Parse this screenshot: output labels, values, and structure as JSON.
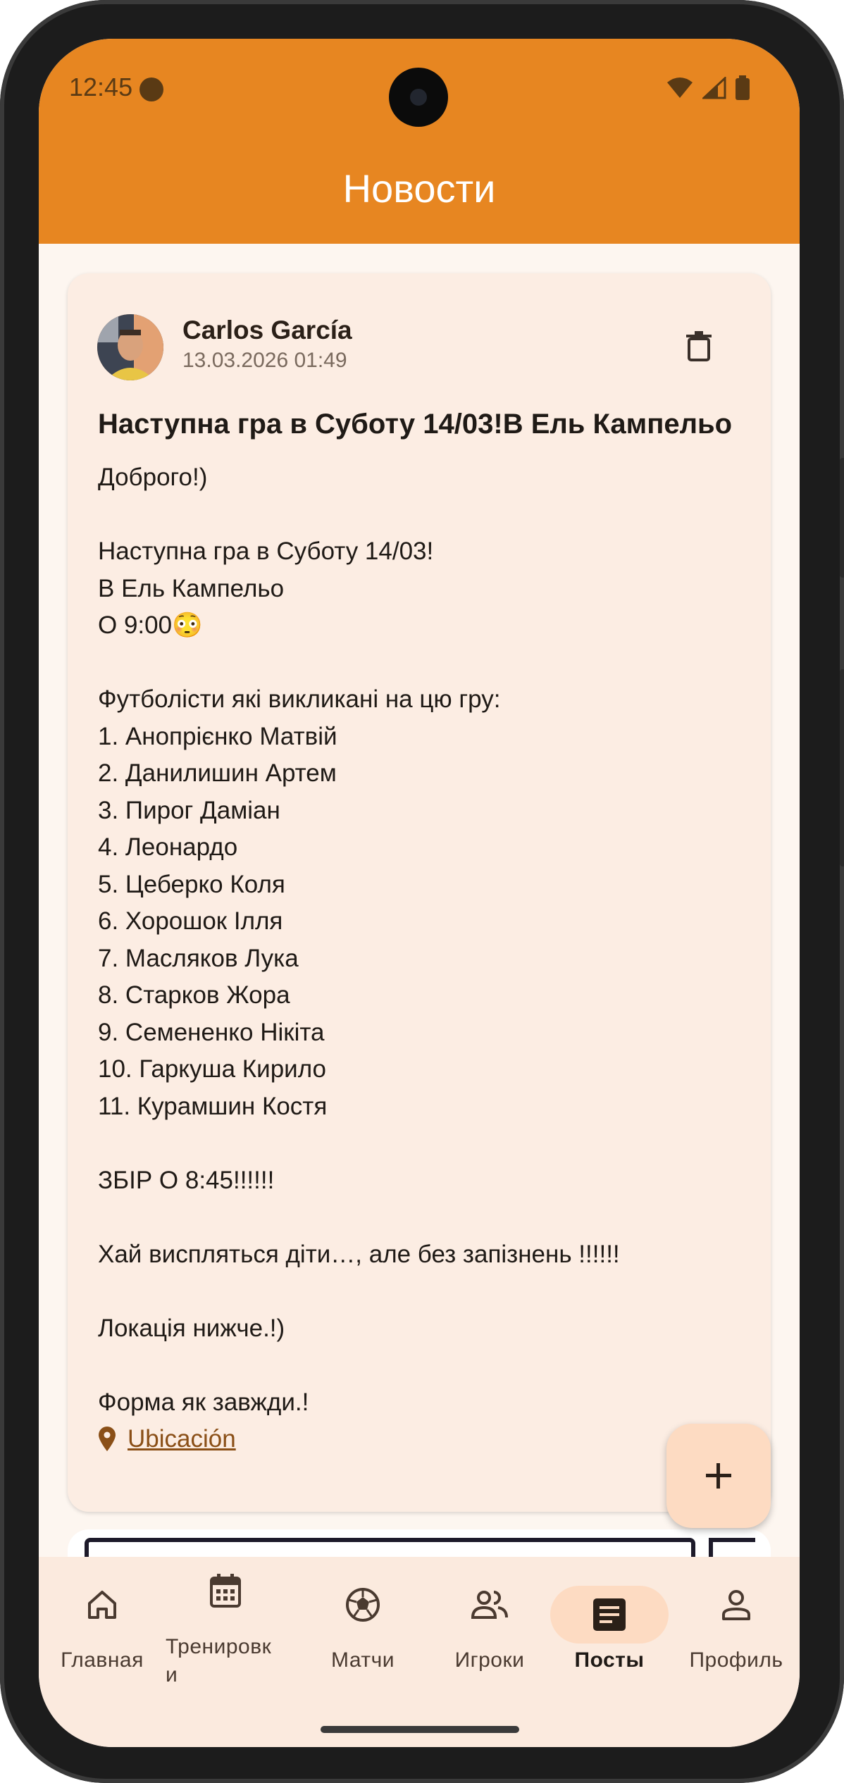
{
  "status_bar": {
    "time": "12:45"
  },
  "appbar": {
    "title": "Новости"
  },
  "post": {
    "author": "Carlos García",
    "date": "13.03.2026 01:49",
    "title": "Наступна гра в Суботу 14/03!В Ель Кампельо",
    "body_lines": [
      "Доброго!)",
      "",
      "Наступна гра в Суботу 14/03!",
      "В Ель Кампельо",
      "О 9:00😳",
      "",
      "Футболісти які викликані на цю гру:",
      "1. Анопрієнко Матвій",
      "2. Данилишин Артем",
      "3. Пирог Даміан",
      "4. Леонардо",
      "5. Цеберко Коля",
      "6. Хорошок Ілля",
      "7. Масляков Лука",
      "8. Старков Жора",
      "9. Семененко Нікіта",
      "10. Гаркуша Кирило",
      "11. Курамшин Костя",
      "",
      "ЗБІР О 8:45!!!!!!",
      "",
      "Хай висплятьcя діти…, але без запізнень !!!!!!",
      "",
      "Локація нижче.!)",
      "",
      "Форма як завжди.!"
    ],
    "location_label": "Ubicación"
  },
  "nav": {
    "items": [
      {
        "label": "Главная",
        "icon": "home-icon"
      },
      {
        "label": "Тренировк\nи",
        "icon": "calendar-icon"
      },
      {
        "label": "Матчи",
        "icon": "soccer-ball-icon"
      },
      {
        "label": "Игроки",
        "icon": "people-icon"
      },
      {
        "label": "Посты",
        "icon": "article-icon"
      },
      {
        "label": "Профиль",
        "icon": "person-icon"
      }
    ],
    "active": "Посты"
  },
  "colors": {
    "appbar": "#e78621",
    "card": "#fcede3",
    "accent": "#8a4f17",
    "fab": "#fddbc2",
    "nav_bg": "#fbeade"
  }
}
